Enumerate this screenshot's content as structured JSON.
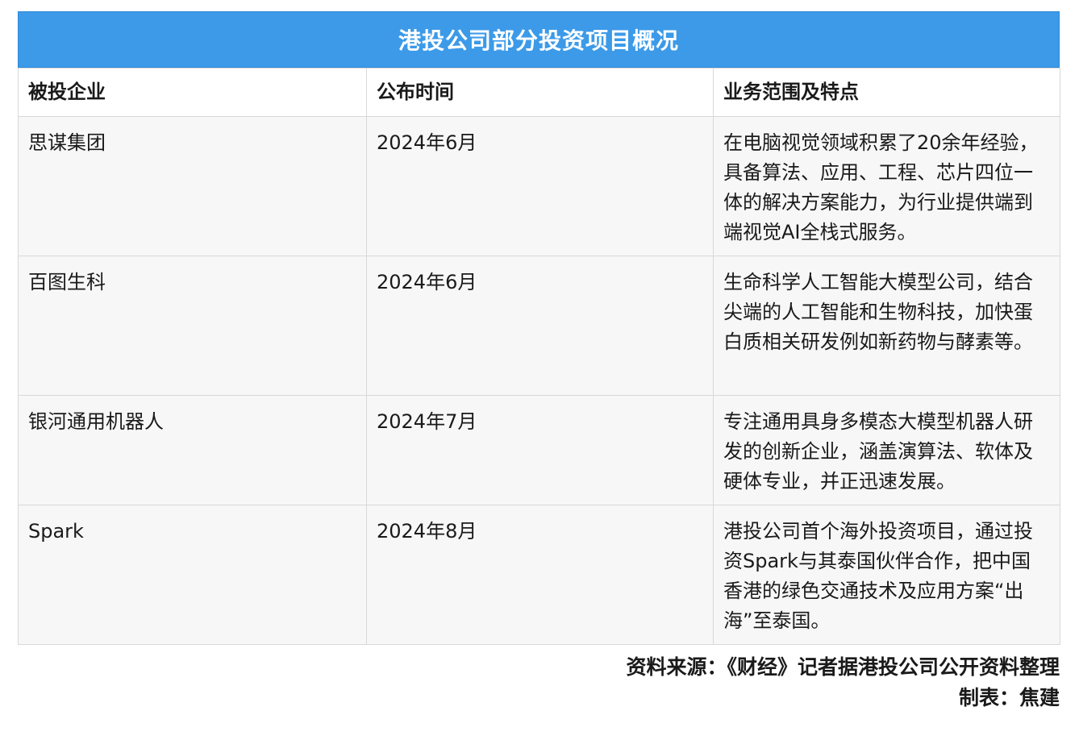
{
  "table": {
    "title": "港投公司部分投资项目概况",
    "headers": [
      "被投企业",
      "公布时间",
      "业务范围及特点"
    ],
    "rows": [
      {
        "company": "思谋集团",
        "date": "2024年6月",
        "description": "在电脑视觉领域积累了20余年经验，具备算法、应用、工程、芯片四位一体的解决方案能力，为行业提供端到端视觉AI全栈式服务。"
      },
      {
        "company": "百图生科",
        "date": "2024年6月",
        "description": "生命科学人工智能大模型公司，结合尖端的人工智能和生物科技，加快蛋白质相关研发例如新药物与酵素等。"
      },
      {
        "company": "银河通用机器人",
        "date": "2024年7月",
        "description": "专注通用具身多模态大模型机器人研发的创新企业，涵盖演算法、软体及硬体专业，并正迅速发展。"
      },
      {
        "company": "Spark",
        "date": "2024年8月",
        "description": "港投公司首个海外投资项目，通过投资Spark与其泰国伙伴合作，把中国香港的绿色交通技术及应用方案“出海”至泰国。"
      }
    ]
  },
  "footer": {
    "source": "资料来源：《财经》记者据港投公司公开资料整理",
    "maker": "制表：焦建"
  },
  "colors": {
    "title_bg": "#3c9ae8",
    "row_bg": "#f7f7f7",
    "border": "#d8d8d8"
  }
}
